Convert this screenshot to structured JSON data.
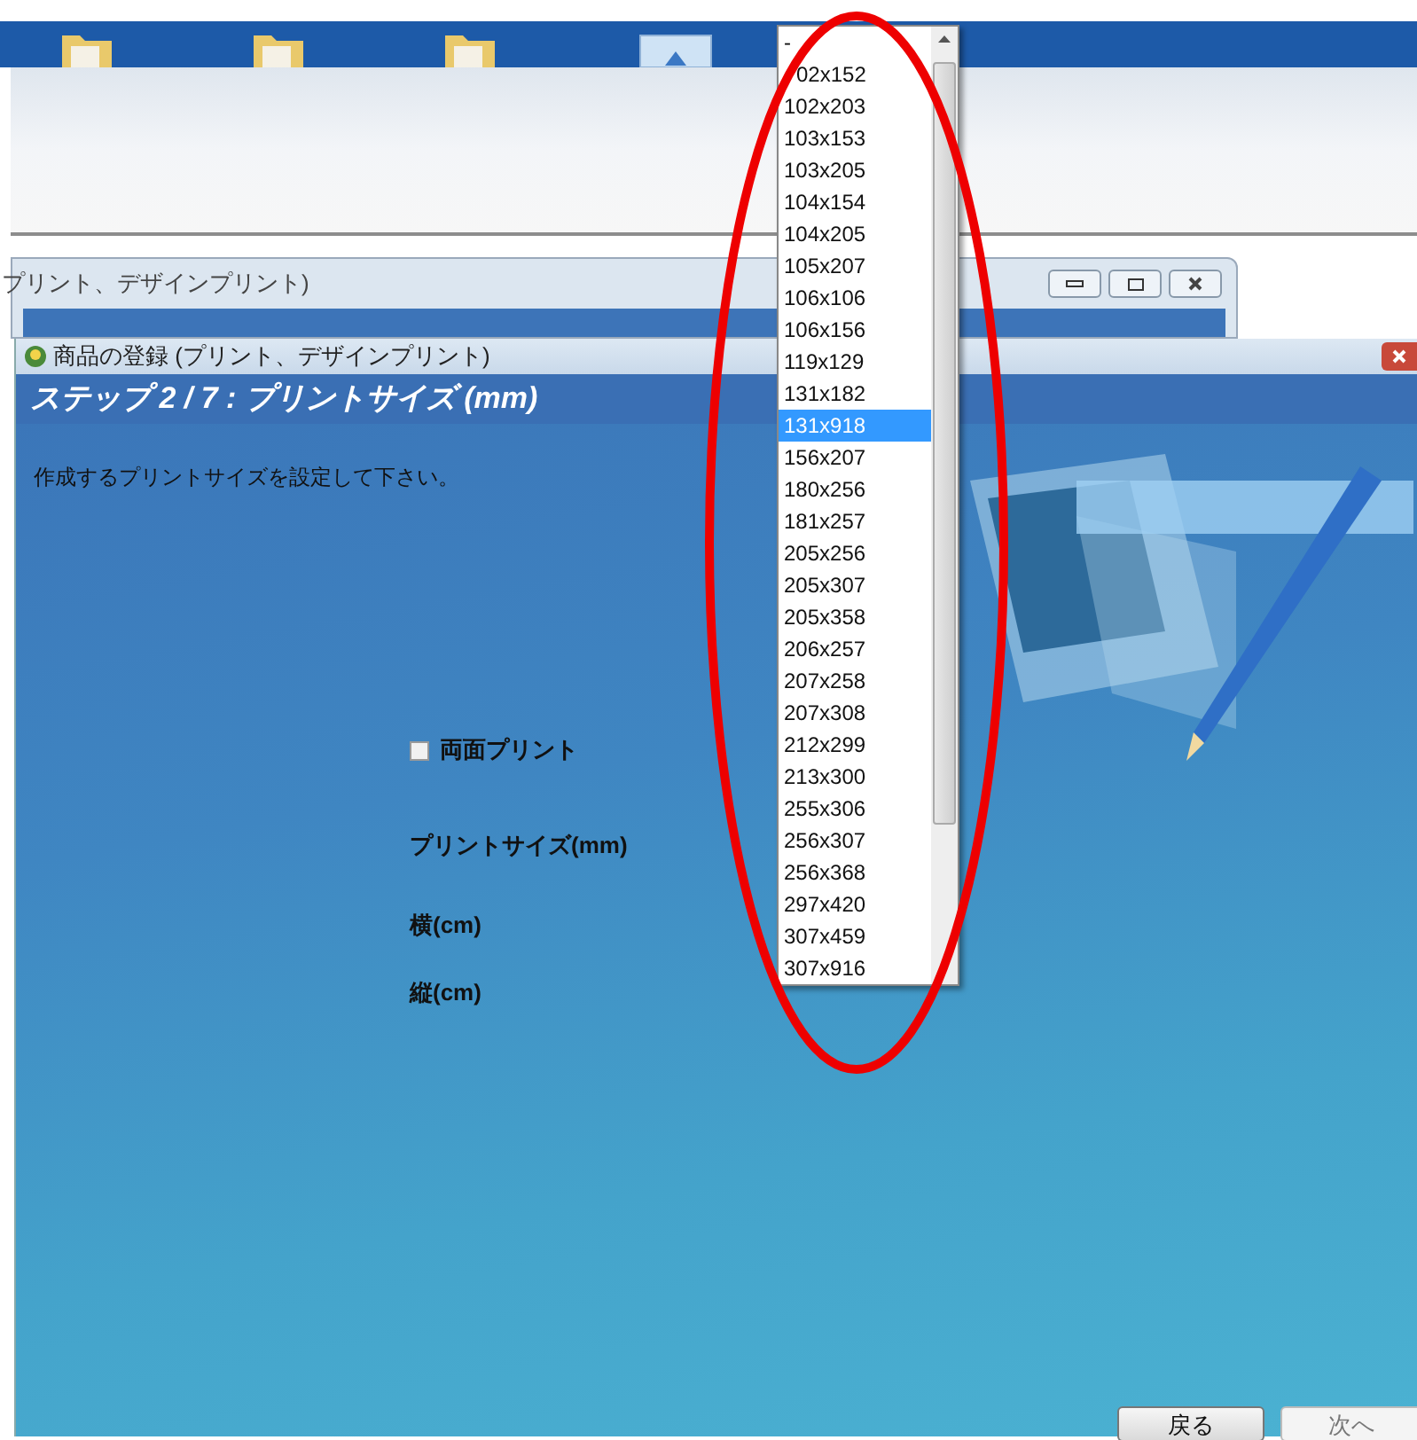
{
  "back_window": {
    "title": "プリント、デザインプリント)"
  },
  "main_window": {
    "title": "商品の登録 (プリント、デザインプリント)"
  },
  "step_header": "ステップ 2 / 7 : プリントサイズ (mm)",
  "instruction": "作成するプリントサイズを設定して下さい。",
  "duplex_checkbox": {
    "label": "両面プリント",
    "checked": false
  },
  "field_labels": [
    "プリントサイズ(mm)",
    "横(cm)",
    "縦(cm)"
  ],
  "dropdown": {
    "items": [
      {
        "label": "-",
        "selected": false
      },
      {
        "label": "02x152",
        "selected": false
      },
      {
        "label": "102x203",
        "selected": false
      },
      {
        "label": "103x153",
        "selected": false
      },
      {
        "label": "103x205",
        "selected": false
      },
      {
        "label": "104x154",
        "selected": false
      },
      {
        "label": "104x205",
        "selected": false
      },
      {
        "label": "105x207",
        "selected": false
      },
      {
        "label": "106x106",
        "selected": false
      },
      {
        "label": "106x156",
        "selected": false
      },
      {
        "label": "119x129",
        "selected": false
      },
      {
        "label": "131x182",
        "selected": false
      },
      {
        "label": "131x918",
        "selected": true
      },
      {
        "label": "156x207",
        "selected": false
      },
      {
        "label": "180x256",
        "selected": false
      },
      {
        "label": "181x257",
        "selected": false
      },
      {
        "label": "205x256",
        "selected": false
      },
      {
        "label": "205x307",
        "selected": false
      },
      {
        "label": "205x358",
        "selected": false
      },
      {
        "label": "206x257",
        "selected": false
      },
      {
        "label": "207x258",
        "selected": false
      },
      {
        "label": "207x308",
        "selected": false
      },
      {
        "label": "212x299",
        "selected": false
      },
      {
        "label": "213x300",
        "selected": false
      },
      {
        "label": "255x306",
        "selected": false
      },
      {
        "label": "256x307",
        "selected": false
      },
      {
        "label": "256x368",
        "selected": false
      },
      {
        "label": "297x420",
        "selected": false
      },
      {
        "label": "307x459",
        "selected": false
      },
      {
        "label": "307x916",
        "selected": false
      }
    ]
  },
  "buttons": [
    {
      "label": "戻る",
      "disabled": false
    },
    {
      "label": "次へ",
      "disabled": true
    }
  ]
}
